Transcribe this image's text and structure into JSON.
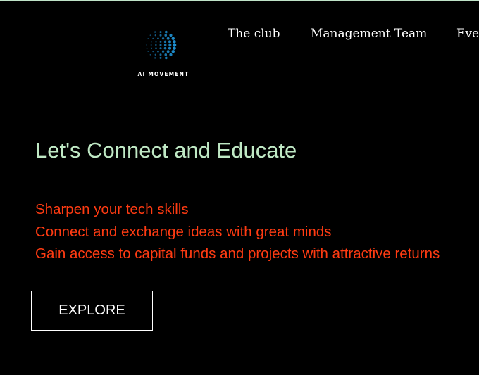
{
  "brand": {
    "logo_text": "AI MOVEMENT",
    "logo_icon": "dotted-globe-icon",
    "logo_color": "#1e8fd0"
  },
  "nav": {
    "items": [
      {
        "label": "The club"
      },
      {
        "label": "Management Team"
      },
      {
        "label": "Events"
      }
    ]
  },
  "hero": {
    "headline": "Let's Connect and Educate",
    "features": [
      "Sharpen your tech skills",
      "Connect and exchange ideas with great minds",
      "Gain access to capital funds and projects with attractive returns"
    ],
    "cta_label": "EXPLORE"
  },
  "colors": {
    "background": "#000000",
    "headline": "#bfe8c4",
    "features": "#ff3b12",
    "accent_border": "#bfe3c8"
  }
}
